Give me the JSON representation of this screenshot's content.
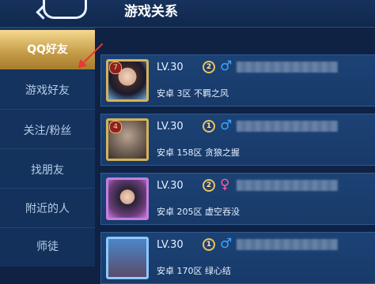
{
  "header": {
    "title": "游戏关系"
  },
  "sidebar": {
    "items": [
      {
        "label": "QQ好友",
        "active": true
      },
      {
        "label": "游戏好友"
      },
      {
        "label": "关注/粉丝"
      },
      {
        "label": "找朋友"
      },
      {
        "label": "附近的人"
      },
      {
        "label": "师徒"
      }
    ]
  },
  "friends": [
    {
      "level": "LV.30",
      "tier": "2",
      "gender": "male",
      "gender_symbol": "♂",
      "server": "安卓 3区 不羁之风",
      "rank_badge": "7"
    },
    {
      "level": "LV.30",
      "tier": "1",
      "gender": "male",
      "gender_symbol": "♂",
      "server": "安卓 158区 贪狼之握",
      "rank_badge": "4"
    },
    {
      "level": "LV.30",
      "tier": "2",
      "gender": "female",
      "gender_symbol": "♀",
      "server": "安卓 205区 虚空吞没",
      "rank_badge": ""
    },
    {
      "level": "LV.30",
      "tier": "1",
      "gender": "male",
      "gender_symbol": "♂",
      "server": "安卓 170区 绿心结",
      "rank_badge": ""
    }
  ],
  "colors": {
    "active_tab": "#c39a45",
    "male": "#3fa3ff",
    "female": "#ff5aa5",
    "pointer": "#e53935"
  }
}
